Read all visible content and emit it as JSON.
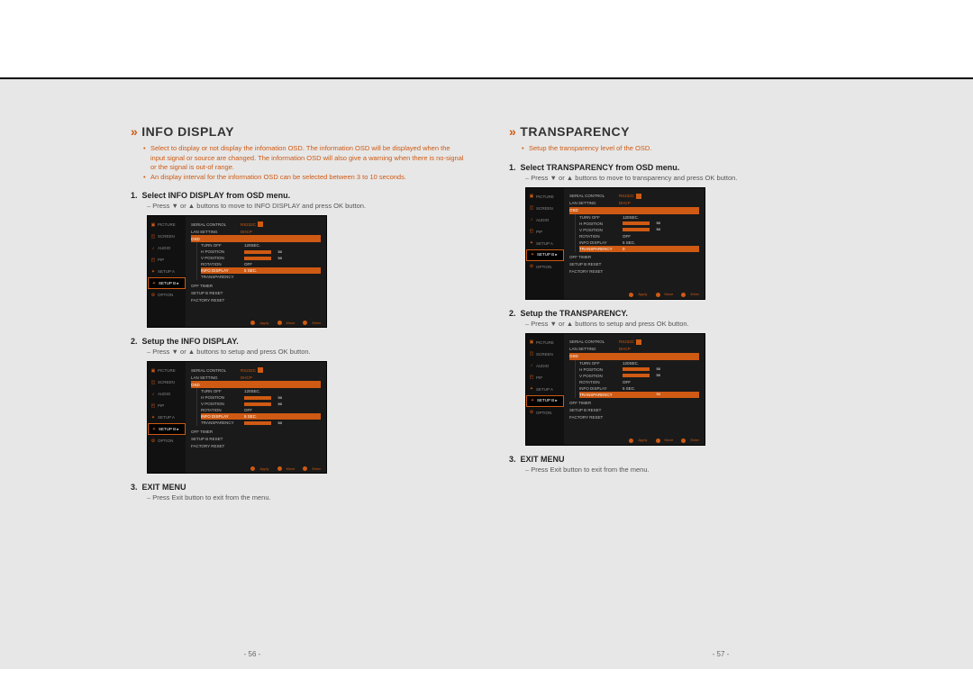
{
  "left": {
    "title": "INFO DISPLAY",
    "bullets": [
      "Select to display or not display the infomation OSD. The information OSD will be displayed when the input signal or source are changed. The information OSD will also give a warning when there is no-signal or the signal is out-of range.",
      "An display interval for the information OSD can be selected between 3 to 10 seconds."
    ],
    "step1": {
      "label": "1.",
      "text": "Select INFO DISPLAY from OSD menu.",
      "sub": "Press ▼ or ▲ buttons to move to INFO DISPLAY and press OK button."
    },
    "step2": {
      "label": "2.",
      "text": "Setup the INFO DISPLAY.",
      "sub": "Press ▼ or ▲ buttons to setup and press OK button."
    },
    "step3": {
      "label": "3.",
      "text": "EXIT MENU",
      "sub": "Press Exit button to exit from the menu."
    },
    "pagenum": "- 56 -"
  },
  "right": {
    "title": "TRANSPARENCY",
    "bullets": [
      "Setup the transparency level of the OSD."
    ],
    "step1": {
      "label": "1.",
      "text": "Select TRANSPARENCY from OSD menu.",
      "sub": "Press ▼ or ▲ buttons to move to transparency and press OK button."
    },
    "step2": {
      "label": "2.",
      "text": "Setup the TRANSPARENCY.",
      "sub": "Press ▼ or ▲ buttons to setup and press OK button."
    },
    "step3": {
      "label": "3.",
      "text": "EXIT MENU",
      "sub": "Press Exit button to exit from the menu."
    },
    "pagenum": "- 57 -"
  },
  "osd": {
    "sidebar": [
      "PICTURE",
      "SCREEN",
      "AUDIO",
      "PIP",
      "SETUP A",
      "SETUP B ▸",
      "OPTION"
    ],
    "rows": {
      "serial": "SERIAL CONTROL",
      "serial_val": "RS232C",
      "lan": "LAN SETTING",
      "lan_val": "DHCP",
      "osd": "OSD",
      "turnoff": "TURN OFF",
      "turnoff_val": "120SEC.",
      "hpos": "H POSITION",
      "vpos": "V POSITION",
      "rot": "ROTATION",
      "rot_val": "OFF",
      "info": "INFO DISPLAY",
      "info_val": "5 SEC.",
      "trans": "TRANSPARENCY",
      "trans_val": "0",
      "offtimer": "OFF TIMER",
      "setupb": "SETUP B RESET",
      "factory": "FACTORY RESET"
    },
    "footer": {
      "a": "Apply",
      "b": "Move",
      "c": "Enter"
    }
  }
}
